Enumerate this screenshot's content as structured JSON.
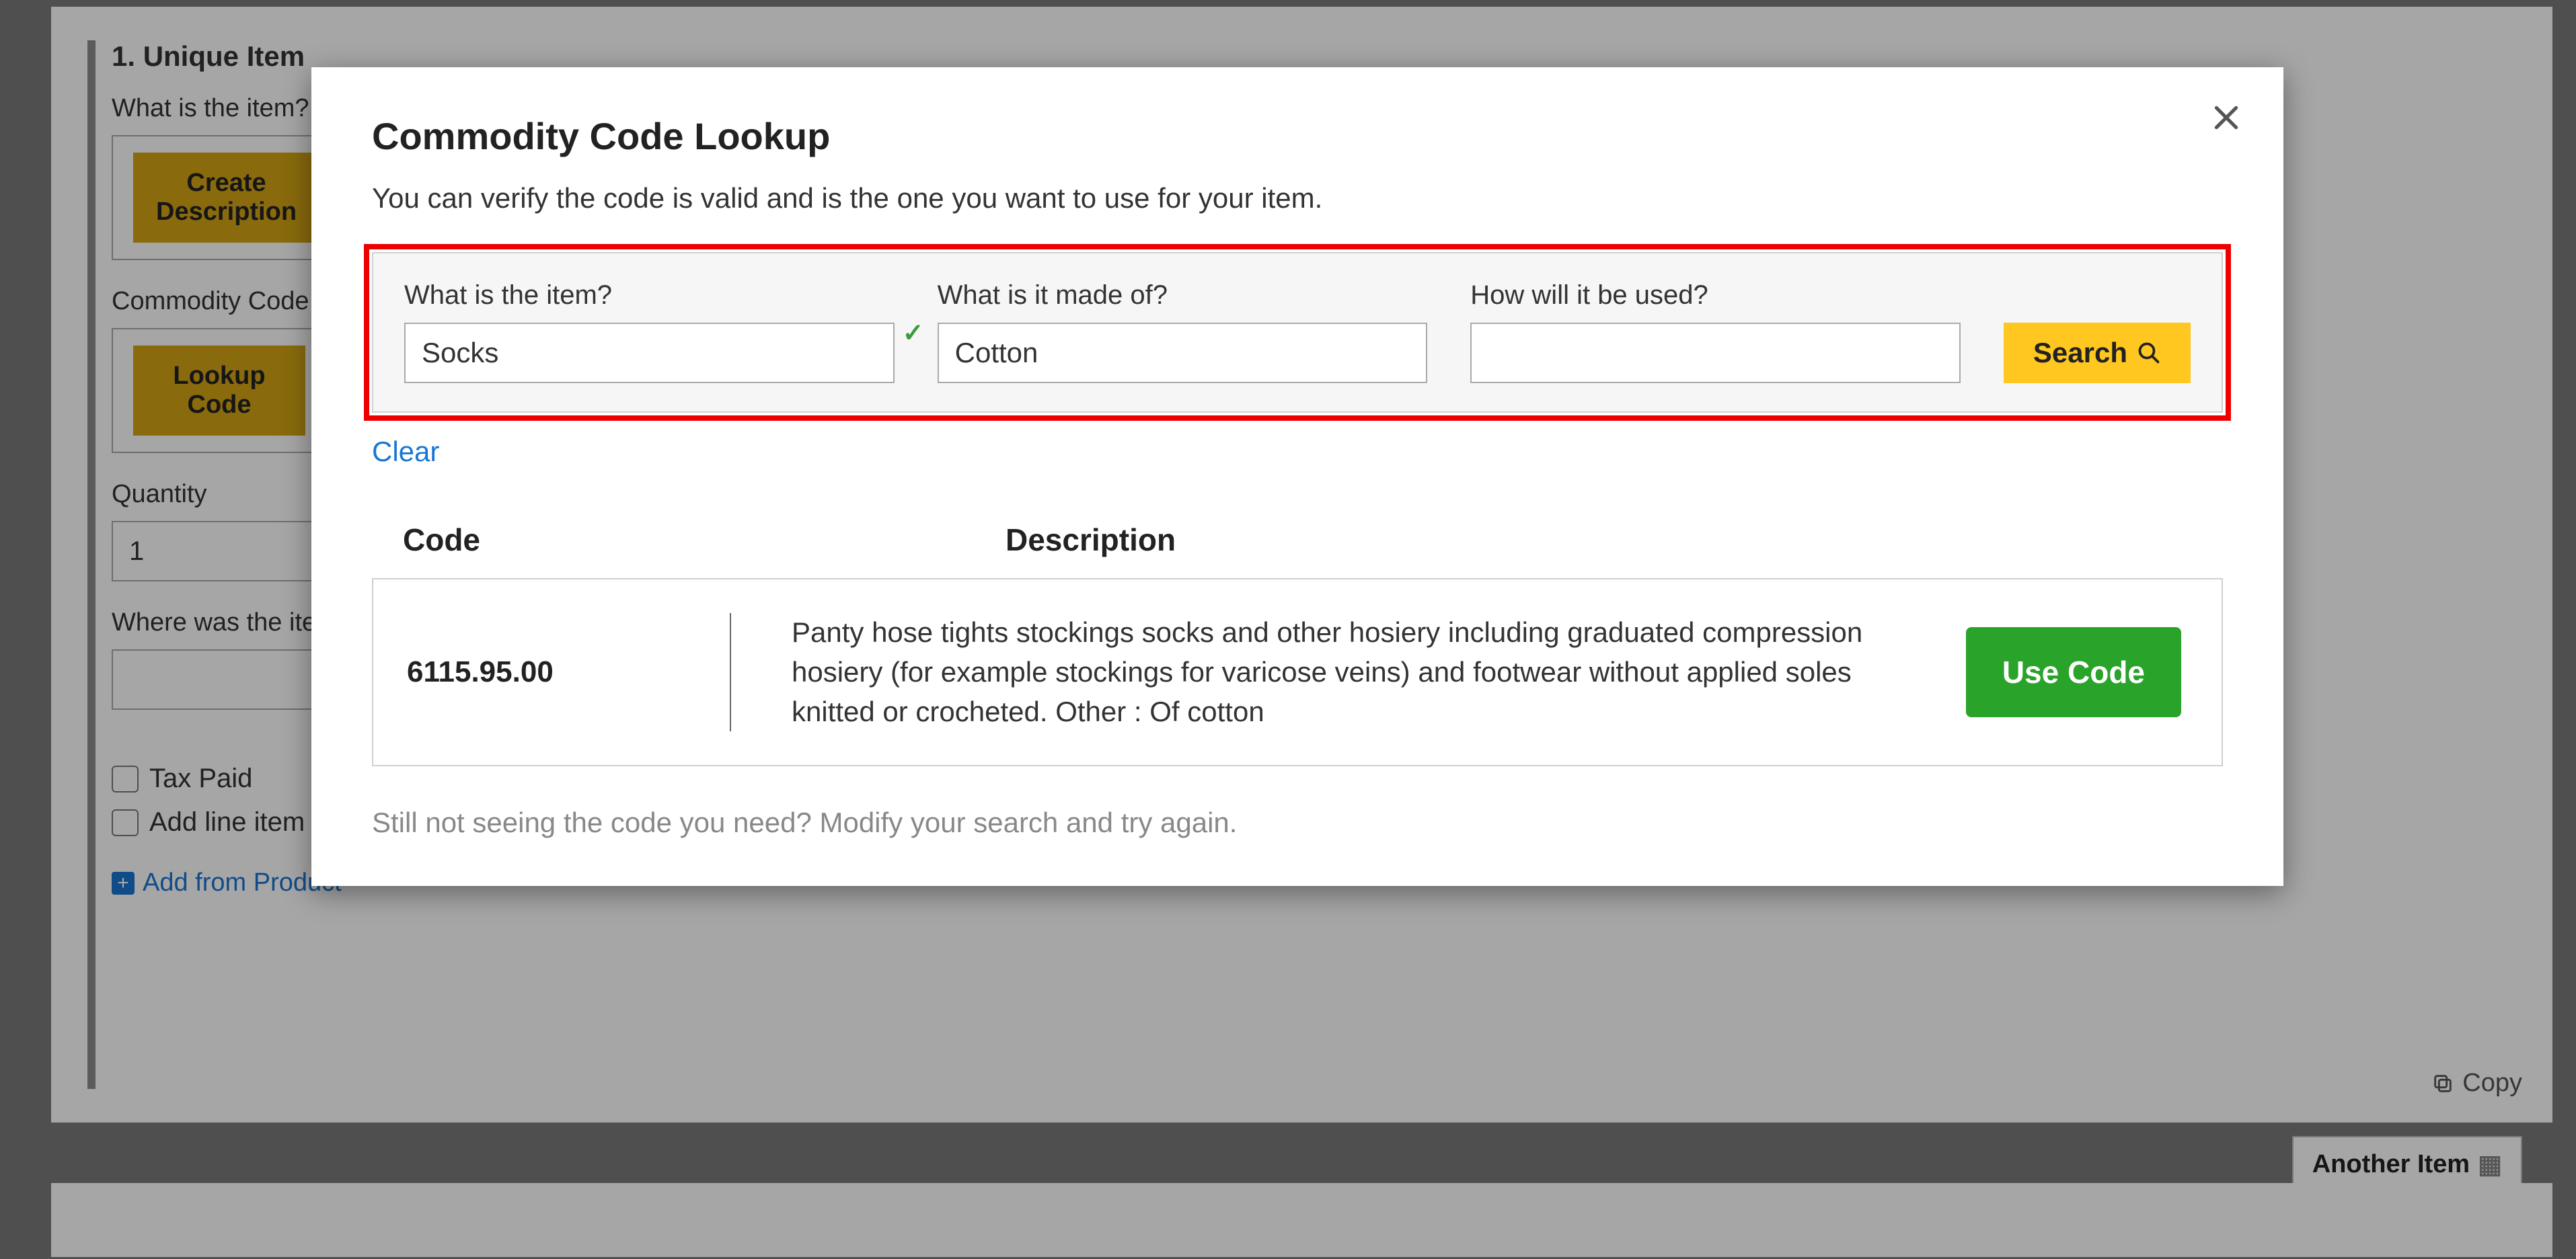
{
  "background": {
    "section_title": "1. Unique Item",
    "item_label": "What is the item?",
    "create_desc_btn": "Create Description",
    "commodity_label": "Commodity Code",
    "lookup_code_btn": "Lookup Code",
    "quantity_label": "Quantity",
    "quantity_value": "1",
    "origin_label": "Where was the item",
    "tax_paid_label": "Tax Paid",
    "add_line_label": "Add line item",
    "add_from_product": "Add from Product",
    "copy_label": "Copy",
    "another_item_label": "Another Item"
  },
  "modal": {
    "title": "Commodity Code Lookup",
    "subtitle": "You can verify the code is valid and is the one you want to use for your item.",
    "item_label": "What is the item?",
    "item_value": "Socks",
    "material_label": "What is it made of?",
    "material_value": "Cotton",
    "use_label": "How will it be used?",
    "use_value": "",
    "search_btn": "Search",
    "clear_link": "Clear",
    "header_code": "Code",
    "header_desc": "Description",
    "result": {
      "code": "6115.95.00",
      "desc": "Panty hose tights stockings socks and other hosiery including graduated compression hosiery (for example stockings for varicose veins) and footwear without applied soles knitted or crocheted. Other : Of cotton",
      "use_code_btn": "Use Code"
    },
    "bottom_hint": "Still not seeing the code you need? Modify your search and try again."
  }
}
